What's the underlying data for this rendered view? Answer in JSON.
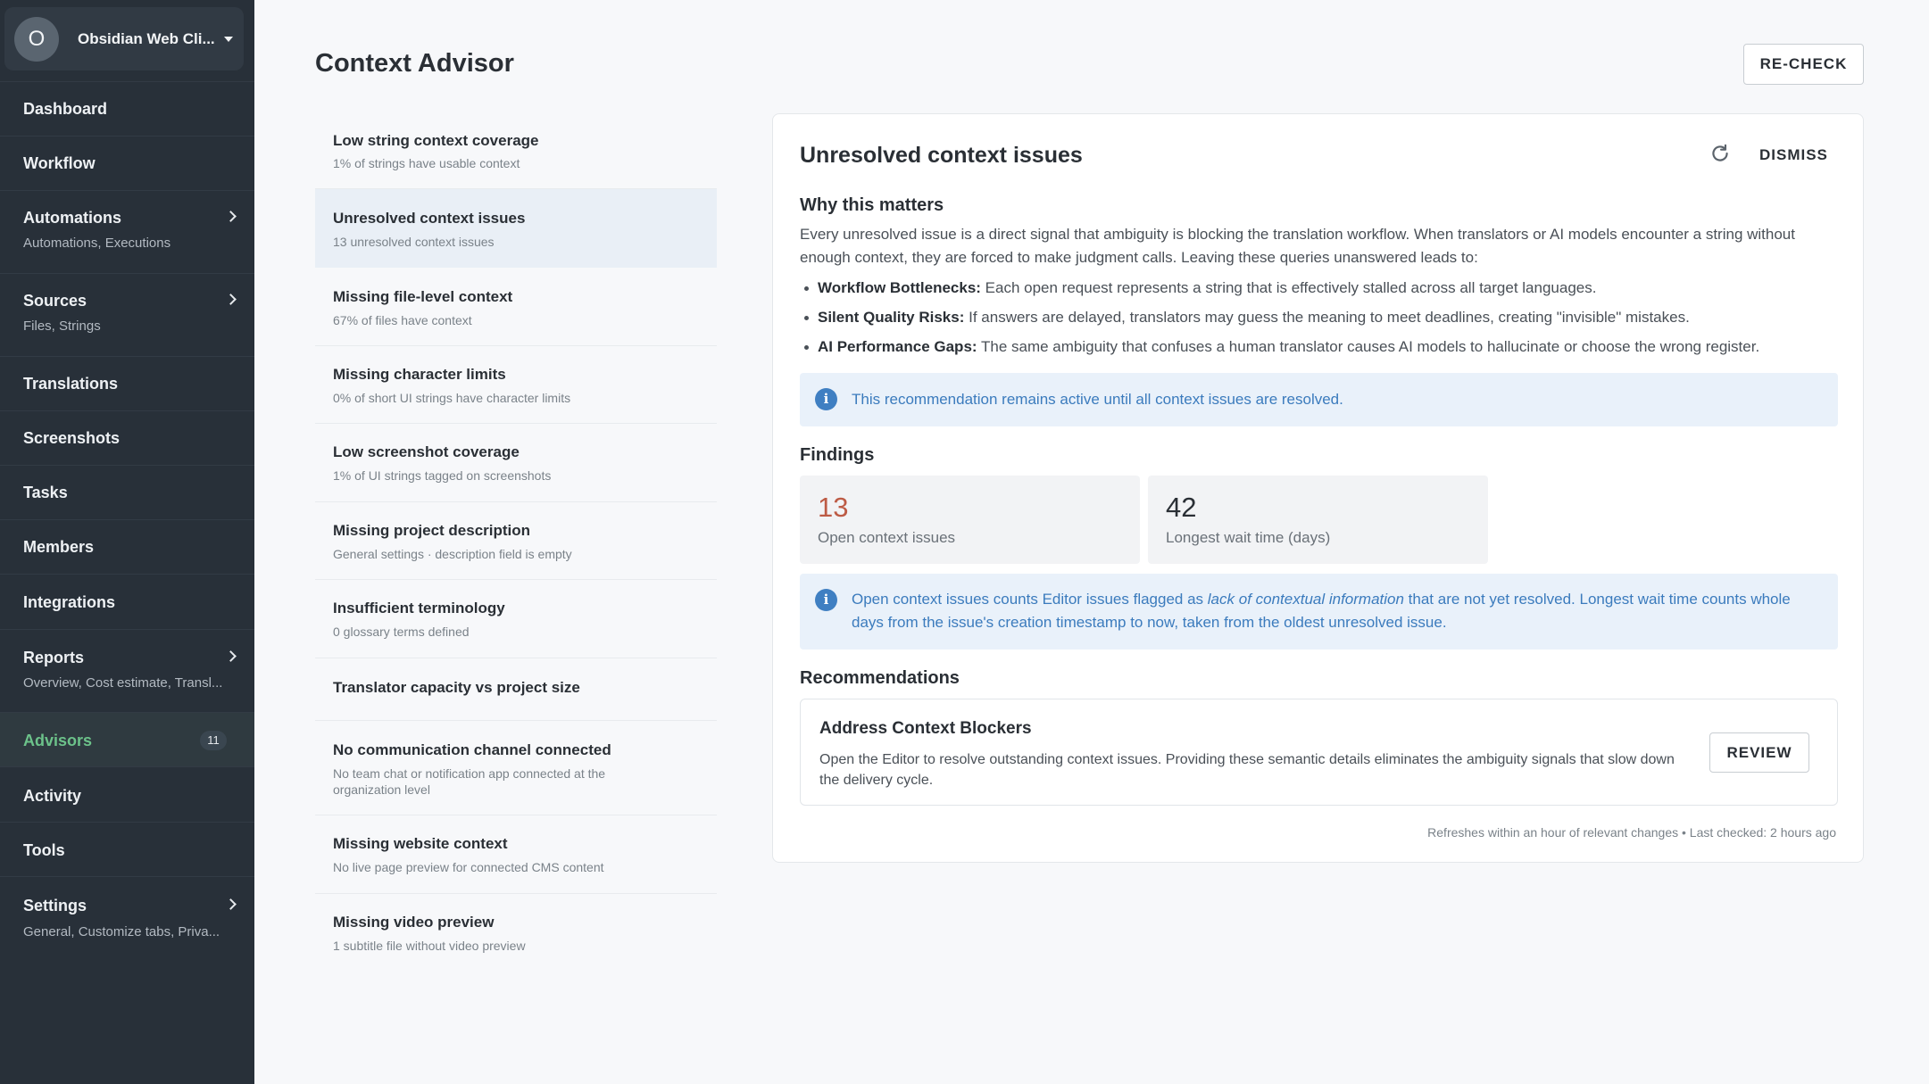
{
  "project": {
    "avatar_letter": "O",
    "name": "Obsidian Web Cli..."
  },
  "nav": {
    "dashboard": "Dashboard",
    "workflow": "Workflow",
    "automations": {
      "label": "Automations",
      "sub": "Automations, Executions"
    },
    "sources": {
      "label": "Sources",
      "sub": "Files, Strings"
    },
    "translations": "Translations",
    "screenshots": "Screenshots",
    "tasks": "Tasks",
    "members": "Members",
    "integrations": "Integrations",
    "reports": {
      "label": "Reports",
      "sub": "Overview, Cost estimate, Transl..."
    },
    "advisors": {
      "label": "Advisors",
      "badge": "11"
    },
    "activity": "Activity",
    "tools": "Tools",
    "settings": {
      "label": "Settings",
      "sub": "General, Customize tabs, Priva..."
    }
  },
  "header": {
    "title": "Context Advisor",
    "recheck": "RE-CHECK"
  },
  "advisors": [
    {
      "title": "Low string context coverage",
      "desc": "1% of strings have usable context"
    },
    {
      "title": "Unresolved context issues",
      "desc": "13 unresolved context issues",
      "selected": true
    },
    {
      "title": "Missing file-level context",
      "desc": "67% of files have context"
    },
    {
      "title": "Missing character limits",
      "desc": "0% of short UI strings have character limits"
    },
    {
      "title": "Low screenshot coverage",
      "desc": "1% of UI strings tagged on screenshots"
    },
    {
      "title": "Missing project description",
      "desc": "General settings · description field is empty"
    },
    {
      "title": "Insufficient terminology",
      "desc": "0 glossary terms defined"
    },
    {
      "title": "Translator capacity vs project size",
      "desc": ""
    },
    {
      "title": "No communication channel connected",
      "desc": "No team chat or notification app connected at the organization level"
    },
    {
      "title": "Missing website context",
      "desc": "No live page preview for connected CMS content"
    },
    {
      "title": "Missing video preview",
      "desc": "1 subtitle file without video preview"
    }
  ],
  "detail": {
    "title": "Unresolved context issues",
    "dismiss": "DISMISS",
    "why_heading": "Why this matters",
    "why_text": "Every unresolved issue is a direct signal that ambiguity is blocking the translation workflow. When translators or AI models encounter a string without enough context, they are forced to make judgment calls. Leaving these queries unanswered leads to:",
    "bullets": [
      {
        "bold": "Workflow Bottlenecks:",
        "text": " Each open request represents a string that is effectively stalled across all target languages."
      },
      {
        "bold": "Silent Quality Risks:",
        "text": " If answers are delayed, translators may guess the meaning to meet deadlines, creating \"invisible\" mistakes."
      },
      {
        "bold": "AI Performance Gaps:",
        "text": " The same ambiguity that confuses a human translator causes AI models to hallucinate or choose the wrong register."
      }
    ],
    "active_note": "This recommendation remains active until all context issues are resolved.",
    "findings_heading": "Findings",
    "findings": [
      {
        "value": "13",
        "label": "Open context issues"
      },
      {
        "value": "42",
        "label": "Longest wait time (days)"
      }
    ],
    "findings_note": {
      "pre": "Open context issues counts Editor issues flagged as ",
      "em": "lack of contextual information",
      "post": " that are not yet resolved. Longest wait time counts whole days from the issue's creation timestamp to now, taken from the oldest unresolved issue."
    },
    "recommendations_heading": "Recommendations",
    "recommendation": {
      "title": "Address Context Blockers",
      "desc": "Open the Editor to resolve outstanding context issues. Providing these semantic details eliminates the ambiguity signals that slow down the delivery cycle.",
      "button": "REVIEW"
    },
    "footnote": "Refreshes within an hour of relevant changes • Last checked: 2 hours ago"
  },
  "colors": {
    "sidebar": "#283039",
    "accent_green": "#6cc28a",
    "info_blue": "#3b7bbd",
    "warn_value": "#bd5b45"
  }
}
